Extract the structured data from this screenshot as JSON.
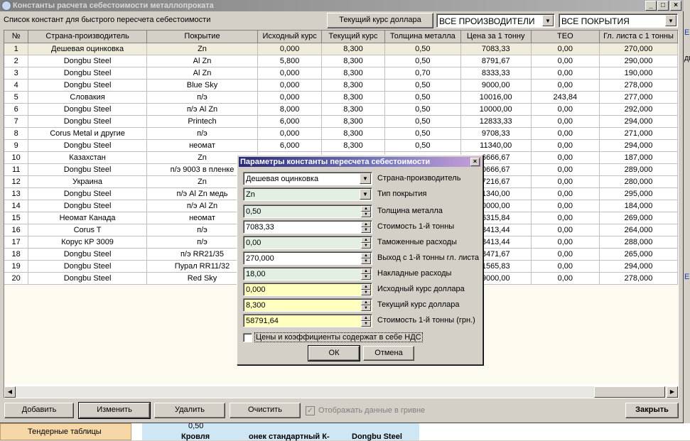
{
  "window": {
    "title": "Константы расчета себестоимости металлопроката",
    "subtitle": "Список констант для быстрого пересчета себестоимости",
    "rate_button": "Текущий курс доллара",
    "filter_manufacturer": "ВСЕ ПРОИЗВОДИТЕЛИ",
    "filter_coating": "ВСЕ ПОКРЫТИЯ"
  },
  "table": {
    "columns": [
      "№",
      "Страна-производитель",
      "Покрытие",
      "Исходный курс",
      "Текущий курс",
      "Толщина металла",
      "Цена за 1 тонну",
      "ТЕО",
      "Гл. листа с 1 тонны"
    ],
    "rows": [
      [
        "1",
        "Дешевая оцинковка",
        "Zn",
        "0,000",
        "8,300",
        "0,50",
        "7083,33",
        "0,00",
        "270,000"
      ],
      [
        "2",
        "Dongbu Steel",
        "Al Zn",
        "5,800",
        "8,300",
        "0,50",
        "8791,67",
        "0,00",
        "290,000"
      ],
      [
        "3",
        "Dongbu Steel",
        "Al Zn",
        "0,000",
        "8,300",
        "0,70",
        "8333,33",
        "0,00",
        "190,000"
      ],
      [
        "4",
        "Dongbu Steel",
        "Blue Sky",
        "0,000",
        "8,300",
        "0,50",
        "9000,00",
        "0,00",
        "278,000"
      ],
      [
        "5",
        "Словакия",
        "п/э",
        "0,000",
        "8,300",
        "0,50",
        "10016,00",
        "243,84",
        "277,000"
      ],
      [
        "6",
        "Dongbu Steel",
        "п/э Al Zn",
        "8,000",
        "8,300",
        "0,50",
        "10000,00",
        "0,00",
        "292,000"
      ],
      [
        "7",
        "Dongbu Steel",
        "Printech",
        "6,000",
        "8,300",
        "0,50",
        "12833,33",
        "0,00",
        "294,000"
      ],
      [
        "8",
        "Corus Metal и другие",
        "п/э",
        "0,000",
        "8,300",
        "0,50",
        "9708,33",
        "0,00",
        "271,000"
      ],
      [
        "9",
        "Dongbu Steel",
        "неомат",
        "6,000",
        "8,300",
        "0,50",
        "11340,00",
        "0,00",
        "294,000"
      ],
      [
        "10",
        "Казахстан",
        "Zn",
        "",
        "",
        "",
        "6666,67",
        "0,00",
        "187,000"
      ],
      [
        "11",
        "Dongbu Steel",
        "п/э 9003 в пленке",
        "",
        "",
        "",
        "0666,67",
        "0,00",
        "289,000"
      ],
      [
        "12",
        "Украина",
        "Zn",
        "",
        "",
        "",
        "7216,67",
        "0,00",
        "280,000"
      ],
      [
        "13",
        "Dongbu Steel",
        "п/э Al Zn медь",
        "",
        "",
        "",
        "1340,00",
        "0,00",
        "295,000"
      ],
      [
        "14",
        "Dongbu Steel",
        "п/э Al Zn",
        "",
        "",
        "",
        "0000,00",
        "0,00",
        "184,000"
      ],
      [
        "15",
        "Неомат Канада",
        "неомат",
        "",
        "",
        "",
        "6315,84",
        "0,00",
        "269,000"
      ],
      [
        "16",
        "Corus T",
        "п/э",
        "",
        "",
        "",
        "8413,44",
        "0,00",
        "264,000"
      ],
      [
        "17",
        "Корус КР 3009",
        "п/э",
        "",
        "",
        "",
        "8413,44",
        "0,00",
        "288,000"
      ],
      [
        "18",
        "Dongbu Steel",
        "п/э RR21/35",
        "",
        "",
        "",
        "8471,67",
        "0,00",
        "265,000"
      ],
      [
        "19",
        "Dongbu Steel",
        "Пурал RR11/32",
        "",
        "",
        "",
        "1565,83",
        "0,00",
        "294,000"
      ],
      [
        "20",
        "Dongbu Steel",
        "Red Sky",
        "",
        "",
        "",
        "9000,00",
        "0,00",
        "278,000"
      ]
    ]
  },
  "dialog": {
    "title": "Параметры константы пересчета себестоимости",
    "fields": [
      {
        "value": "Дешевая оцинковка",
        "label": "Страна-производитель"
      },
      {
        "value": "Zn",
        "label": "Тип покрытия"
      },
      {
        "value": "0,50",
        "label": "Толщина металла"
      },
      {
        "value": "7083,33",
        "label": "Стоимость 1-й тонны"
      },
      {
        "value": "0,00",
        "label": "Таможенные расходы"
      },
      {
        "value": "270,000",
        "label": "Выход с 1-й тонны гл. листа"
      },
      {
        "value": "18,00",
        "label": "Накладные расходы"
      },
      {
        "value": "0,000",
        "label": "Исходный курс доллара"
      },
      {
        "value": "8,300",
        "label": "Текущий курс доллара"
      },
      {
        "value": "58791,64",
        "label": "Стоимость 1-й тонны (грн.)"
      }
    ],
    "vat_checkbox": "Цены и коэффициенты содержат в себе НДС",
    "ok": "ОК",
    "cancel": "Отмена"
  },
  "buttons": {
    "add": "Добавить",
    "edit": "Изменить",
    "delete": "Удалить",
    "clear": "Очистить",
    "show_uah": "Отображать данные в гривне",
    "close": "Закрыть"
  },
  "background": {
    "tender_tables": "Тендерные таблицы",
    "value": "0,50",
    "col1": "Кровля",
    "col2": "онек стандартный К-",
    "col3": "Dongbu Steel",
    "edge_text_1": "Е",
    "edge_text_2": "дк",
    "edge_text_3": "Е"
  }
}
